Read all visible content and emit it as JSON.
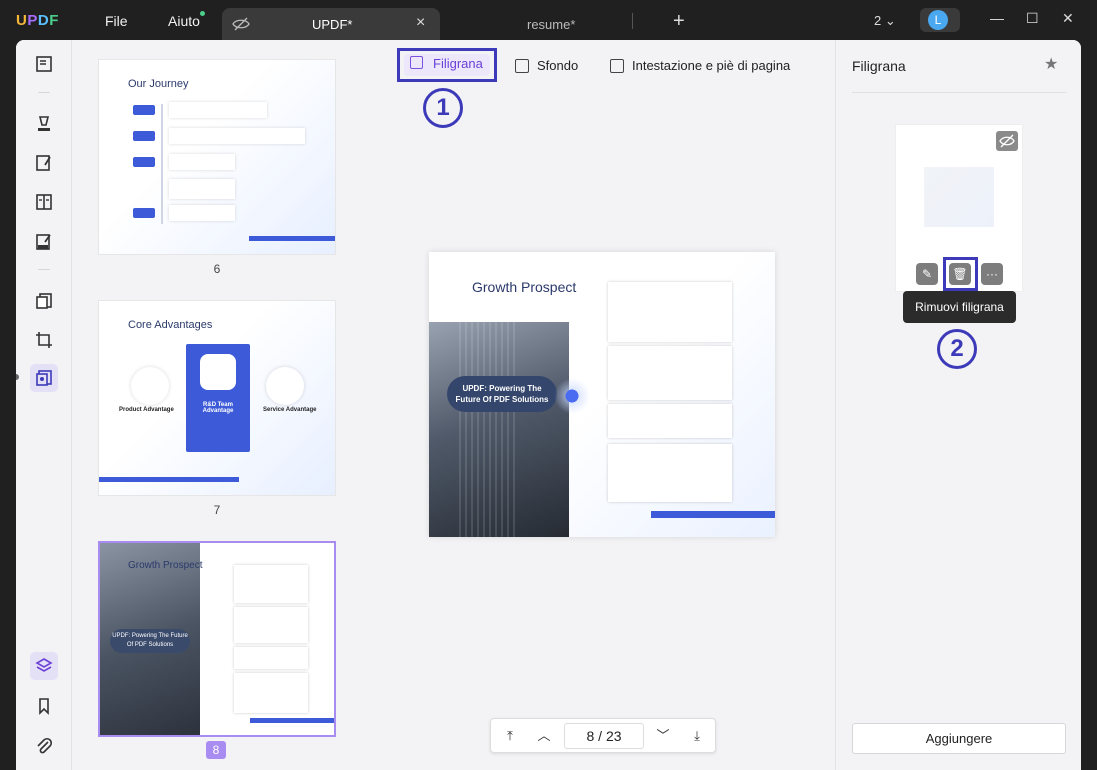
{
  "app": {
    "logo": "UPDF",
    "menu": {
      "file": "File",
      "help": "Aiuto"
    },
    "tabs": [
      {
        "label": "UPDF*",
        "active": true
      },
      {
        "label": "resume*",
        "active": false
      }
    ],
    "page_count_indicator": "2",
    "user_initial": "L"
  },
  "edit_tabs": {
    "watermark": "Filigrana",
    "background": "Sfondo",
    "header_footer": "Intestazione e piè di pagina"
  },
  "callouts": {
    "one": "1",
    "two": "2"
  },
  "thumbnails": {
    "pages": [
      {
        "number": "6",
        "title": "Our Journey"
      },
      {
        "number": "7",
        "title": "Core Advantages",
        "items": [
          "Product Advantage",
          "R&D Team Advantage",
          "Service Advantage"
        ]
      },
      {
        "number": "8",
        "title": "Growth Prospect",
        "active": true
      }
    ]
  },
  "page_preview": {
    "title": "Growth Prospect",
    "badge": "UPDF: Powering The Future Of PDF Solutions"
  },
  "pager": {
    "current": "8",
    "separator": "/",
    "total": "23"
  },
  "right_panel": {
    "title": "Filigrana",
    "tooltip": "Rimuovi filigrana",
    "add_button": "Aggiungere"
  },
  "colors": {
    "accent": "#3d3ab9",
    "purple": "#7a52e0",
    "thumb_active": "#a98cf2"
  }
}
